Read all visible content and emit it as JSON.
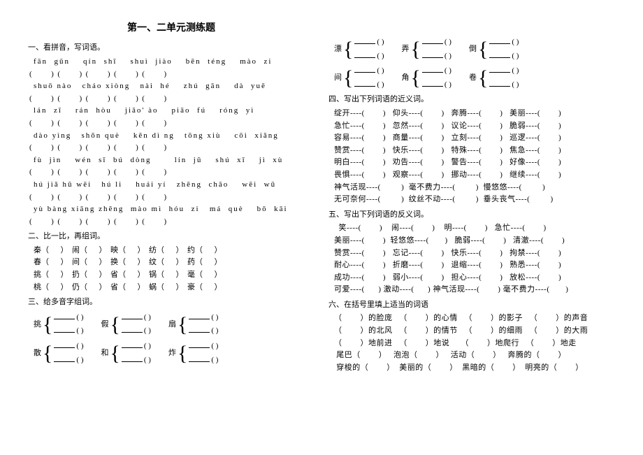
{
  "title": "第一、二单元测练题",
  "s1": {
    "head": "一、看拼音，写词语。",
    "rows": [
      "fān  gǔn    qín  shī    shuì  jiào    bēn  téng    mào  zi",
      "shuō nào   cháo xiòng   nài  hé    zhú  gān    dà  yuē",
      "lán  zǐ    rán  hòu    jiāo' ào    piāo  fú    róng  yì",
      "dào yìng   shǒn què    kěn dì ng   tōng xiù    cōi  xiǎng",
      "fù  jìn    wén  sī  bú  dòng       lín  jū    shú  xī    jì  xù",
      "hú jiǎ hū wēi   hú li    huái yí   zhēng  chāo    wēi  wū",
      "yù bàng xiāng zhēng  mào mì  hóu  zi   má  què    bō  kāi"
    ],
    "paren": "(          )  (          )  (          )  (          )  (          )"
  },
  "s2": {
    "head": "二、比一比，再组词。",
    "rows": [
      "秦（      ）  闹（      ）  映（      ）  纺（      ）  约（      ）",
      "春（      ）  间（      ）  换（      ）  纹（      ）  药（      ）",
      "挑（      ）  扔（      ）  省（      ）  锅（      ）  毫（      ）",
      "桃（      ）  仍（      ）  省（      ）  蜗（      ）  豪（      ）"
    ]
  },
  "s3": {
    "head": "三、给多音字组词。",
    "g1": [
      "挑",
      "假",
      "扇"
    ],
    "g2": [
      "散",
      "和",
      "炸"
    ],
    "g3": [
      "漂",
      "弄",
      "倒"
    ],
    "g4": [
      "间",
      "角",
      "卷"
    ]
  },
  "s4": {
    "head": "四、写出下列词语的近义词。",
    "rows": [
      "绽开----(        )   仰头----(        )   奔腾----(        )   美丽----(        )",
      "急忙----(        )   忽然----(        )   议论----(        )   脆弱----(        )",
      "容易----(        )   商量----(        )   立刻----(        )   巡逻----(        )",
      "赞赏----(        )   快乐----(        )   特殊----(        )   焦急----(        )",
      "明白----(        )   劝告----(        )   警告----(        )   好像----(        )",
      "畏惧----(        )   观察----(        )   挪动----(        )   继续----(        )",
      "神气活现----(         )  毫不费力----(         )  慢悠悠----(         )",
      "无可奈何----(         )  纹丝不动----(         )  垂头丧气----(         )"
    ]
  },
  "s5": {
    "head": "五、写出下列词语的反义词。",
    "rows": [
      "  笑----(        )    闹----(        )    明----(        )   急忙----(        )",
      "美丽----(        )  轻悠悠----(       )   脆弱----(        )   清澈----(        )",
      "赞赏----(        )   忘记----(        )   快乐----(        )   拘禁----(        )",
      "耐心----(        )   折磨----(        )   退缩----(        )   熟悉----(        )",
      "成功----(        )   弱小----(        )   担心----(        )   放松----(        )",
      "可爱----(      ) 激动----(      ) 神气活现----(        ) 毫不费力----(       )"
    ]
  },
  "s6": {
    "head": "六、在括号里填上适当的词语",
    "rows": [
      "（        ）的脸庞   （        ）的心情   （        ）的影子   （        ）的声音",
      "（        ）的北风   （        ）的情节   （        ）的细雨   （        ）的大雨",
      "（        ）地前进   （        ）地说     （        ）地爬行   （        ）地走",
      " 尾巴（        ）   泡泡（        ）   活动（        ）   奔腾的（        ）",
      " 穿梭的（        ）  美丽的（        ）  黑暗的（        ）  明亮的（        ）"
    ]
  }
}
